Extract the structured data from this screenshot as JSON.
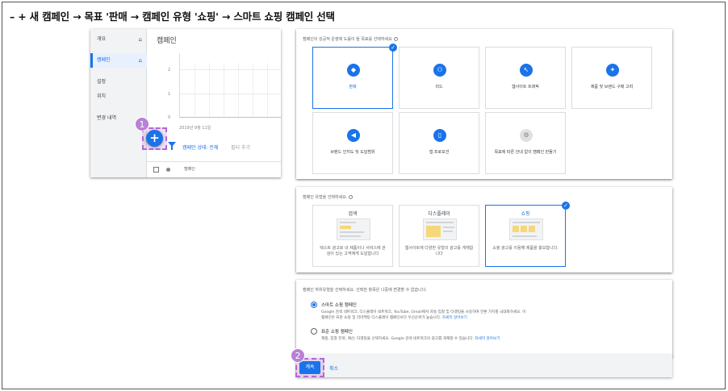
{
  "heading": "– + 새 캠페인 → 목표 '판매 → 캠페인 유형 '쇼핑' → 스마트 쇼핑 캠페인 선택",
  "left_panel": {
    "sidebar": [
      {
        "label": "개요",
        "home": true,
        "active": false
      },
      {
        "label": "캠페인",
        "home": true,
        "active": true
      },
      {
        "label": "설정",
        "home": false,
        "active": false
      },
      {
        "label": "위치",
        "home": false,
        "active": false
      },
      {
        "label": "변경 내역",
        "home": false,
        "active": false
      }
    ],
    "title": "캠페인",
    "chart": {
      "y_ticks": [
        "2",
        "1",
        "0"
      ],
      "date": "2019년 9월 11일"
    },
    "status_filter": "캠페인 상태: 전체",
    "add_filter": "필터 추가",
    "row_label": "캠페인",
    "plus_label": "+",
    "step1": "1"
  },
  "goal_panel": {
    "title": "캠페인의 성공적 운영에 도움이 될 목표를 선택하세요",
    "goals": [
      {
        "label": "판매",
        "icon": "tag-icon",
        "glyph": "◆",
        "selected": true,
        "grey": false
      },
      {
        "label": "리드",
        "icon": "people-icon",
        "glyph": "⚇",
        "selected": false,
        "grey": false
      },
      {
        "label": "웹사이트 트래픽",
        "icon": "cursor-icon",
        "glyph": "↖",
        "selected": false,
        "grey": false
      },
      {
        "label": "제품 및 브랜드 구매 고려",
        "icon": "sparkle-icon",
        "glyph": "✦",
        "selected": false,
        "grey": false
      },
      {
        "label": "브랜드 인지도 및 도달범위",
        "icon": "megaphone-icon",
        "glyph": "◀",
        "selected": false,
        "grey": false
      },
      {
        "label": "앱 프로모션",
        "icon": "phone-icon",
        "glyph": "▯",
        "selected": false,
        "grey": false
      },
      {
        "label": "목표에 따른 안내 없이 캠페인 만들기",
        "icon": "gear-icon",
        "glyph": "⚙",
        "selected": false,
        "grey": true
      }
    ]
  },
  "type_panel": {
    "title": "캠페인 유형을 선택하세요.",
    "types": [
      {
        "title": "검색",
        "desc": "텍스트 광고로 내 제품이나 서비스에 관심이 있는 고객에게 도달합니다",
        "selected": false
      },
      {
        "title": "디스플레이",
        "desc": "웹사이트에 다양한 유형의 광고를 게재합니다",
        "selected": false
      },
      {
        "title": "쇼핑",
        "desc": "쇼핑 광고를 이용해 제품을 홍보합니다.",
        "selected": true
      }
    ]
  },
  "subtype_panel": {
    "title": "캠페인 하위유형을 선택하세요. 선택한 항목은 나중에 변경할 수 없습니다.",
    "smart": {
      "label": "스마트 쇼핑 캠페인",
      "desc1": "Google 검색 네트워크, 디스플레이 네트워크, YouTube, Gmail에서 자동 입찰 및 타겟팅을 사용하여 전환 가치를 극대화하세요. 이",
      "desc2": "캠페인은 표준 쇼핑 및 리마케팅 디스플레이 캠페인보다 우선순위가 높습니다.",
      "link": "자세히 알아보기"
    },
    "standard": {
      "label": "표준 쇼핑 캠페인",
      "desc": "제품, 입찰 전략, 예산, 타겟팅을 선택하세요. Google 검색 네트워크의 광고를 게재할 수 있습니다.",
      "link": "자세히 알아보기"
    },
    "selected": "smart"
  },
  "footer": {
    "continue": "계속",
    "cancel": "취소",
    "step2": "2"
  },
  "colors": {
    "accent": "#1a73e8",
    "highlight": "#b565d8"
  }
}
